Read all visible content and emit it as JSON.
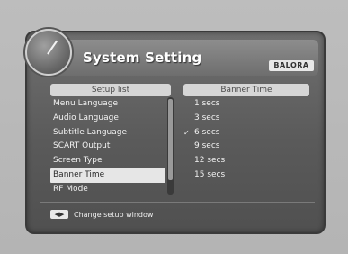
{
  "window": {
    "title": "System Setting",
    "brand": "BALORA"
  },
  "setup_list": {
    "header": "Setup list",
    "items": [
      {
        "label": "Menu Language"
      },
      {
        "label": "Audio Language"
      },
      {
        "label": "Subtitle Language"
      },
      {
        "label": "SCART Output"
      },
      {
        "label": "Screen Type"
      },
      {
        "label": "Banner Time",
        "selected": true
      },
      {
        "label": "RF Mode"
      }
    ]
  },
  "banner_time": {
    "header": "Banner Time",
    "options": [
      {
        "label": "1 secs"
      },
      {
        "label": "3 secs"
      },
      {
        "label": "6 secs",
        "checked": true
      },
      {
        "label": "9 secs"
      },
      {
        "label": "12 secs"
      },
      {
        "label": "15 secs"
      }
    ]
  },
  "footer": {
    "key_icon": "left-right-arrows-icon",
    "key_glyph": "◀▶",
    "hint": "Change setup window"
  }
}
